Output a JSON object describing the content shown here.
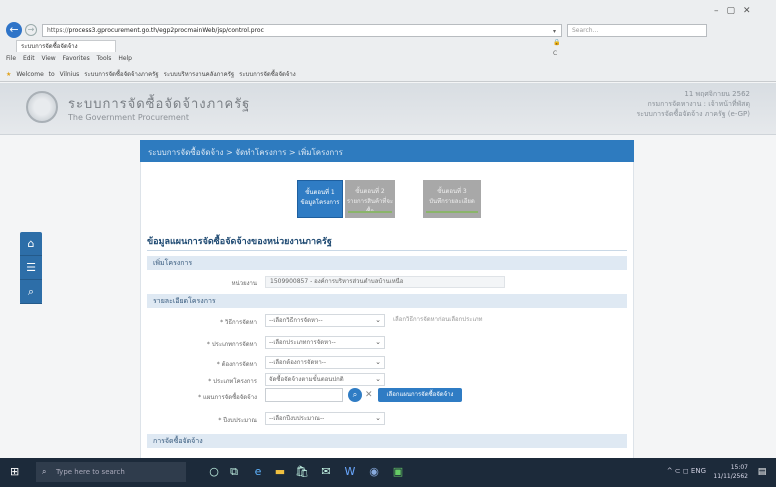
{
  "browser": {
    "url_prefix": "https://",
    "url": "process3.gprocurement.go.th/egp2procmainWeb/jsp/control.proc",
    "addr_tools": "▾ 🔒 C",
    "search_placeholder": "Search...",
    "tab_title": "ระบบการจัดซื้อจัดจ้าง",
    "menu_items": "File Edit View Favorites Tools Help",
    "favorites": [
      "Welcome to Vilnius",
      "ระบบการจัดซื้อจัดจ้างภาครัฐ",
      "ระบบบริหารงานคลังภาครัฐ",
      "ระบบการจัดซื้อจัดจ้าง"
    ]
  },
  "header": {
    "title": "ระบบการจัดซื้อจัดจ้างภาครัฐ",
    "subtitle": "The Government Procurement",
    "user_line1": "11 พฤศจิกายน 2562",
    "user_line2": "กรมการจัดหางาน : เจ้าหน้าที่พัสดุ",
    "user_line3": "ระบบการจัดซื้อจัดจ้าง ภาครัฐ (e-GP)"
  },
  "panel": {
    "title": "ระบบการจัดซื้อจัดจ้าง > จัดทำโครงการ > เพิ่มโครงการ",
    "steps": [
      {
        "line1": "ขั้นตอนที่ 1",
        "line2": "ข้อมูลโครงการ"
      },
      {
        "line1": "ขั้นตอนที่ 2",
        "line2": "รายการสินค้าที่จะซื้อ"
      },
      {
        "line1": "ขั้นตอนที่ 3",
        "line2": "บันทึกรายละเอียด"
      }
    ],
    "section_title": "ข้อมูลแผนการจัดซื้อจัดจ้างของหน่วยงานภาครัฐ",
    "sub_agency": "เพิ่มโครงการ",
    "agency_label": "หน่วยงาน",
    "agency_value": "1509900857 - องค์การบริหารส่วนตำบลบ้านเหนือ",
    "sub_details": "รายละเอียดโครงการ",
    "fields": [
      {
        "label": "* วิธีการจัดหา",
        "value": "--เลือกวิธีการจัดหา--"
      },
      {
        "label": "* ประเภทการจัดหา",
        "value": "--เลือกประเภทการจัดหา--"
      },
      {
        "label": "* ต้องการจัดหา",
        "value": "--เลือกต้องการจัดหา--"
      },
      {
        "label": "* ประเภทโครงการ",
        "value": "จัดซื้อจัดจ้างตามขั้นตอนปกติ"
      }
    ],
    "method_hint": "เลือกวิธีการจัดหาก่อนเลือกประเภท",
    "plan_label": "* แผนการจัดซื้อจัดจ้าง",
    "plan_search_btn": "เลือกแผนการจัดซื้อจัดจ้าง",
    "budget_label": "* ปีงบประมาณ",
    "budget_value": "--เลือกปีงบประมาณ--",
    "sub_procurement": "การจัดซื้อจัดจ้าง"
  },
  "taskbar": {
    "search_placeholder": "Type here to search",
    "tray": "^ ⊂ ◻ ENG",
    "time": "15:07",
    "date": "11/11/2562"
  }
}
